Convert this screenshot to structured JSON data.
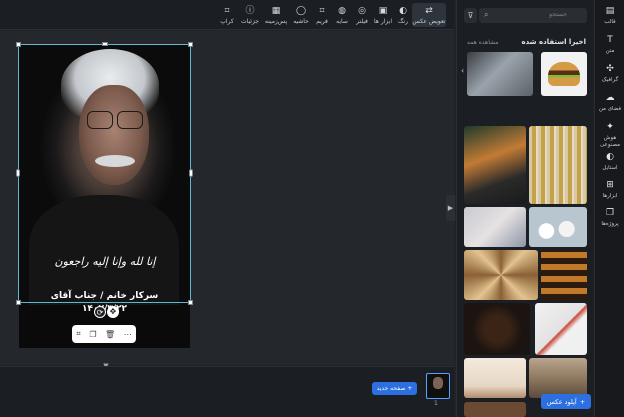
{
  "toolbar": {
    "tools": [
      {
        "id": "change-photo",
        "label": "تعویض عکس",
        "icon": "swap-icon",
        "glyph": "⇄"
      },
      {
        "id": "color",
        "label": "رنگ",
        "icon": "palette-icon",
        "glyph": "◐"
      },
      {
        "id": "photo-tools",
        "label": "ابزار ها",
        "icon": "image-tools-icon",
        "glyph": "▣"
      },
      {
        "id": "filter",
        "label": "فیلتر",
        "icon": "filter-icon",
        "glyph": "◎"
      },
      {
        "id": "shadow",
        "label": "سایه",
        "icon": "shadow-icon",
        "glyph": "◍"
      },
      {
        "id": "frame",
        "label": "فریم",
        "icon": "frame-icon",
        "glyph": "⌗"
      },
      {
        "id": "border",
        "label": "حاشیه",
        "icon": "border-icon",
        "glyph": "◯"
      },
      {
        "id": "background",
        "label": "پس‌زمینه",
        "icon": "background-icon",
        "glyph": "▦"
      },
      {
        "id": "details",
        "label": "جزئیات",
        "icon": "info-icon",
        "glyph": "ⓘ"
      },
      {
        "id": "crop",
        "label": "کراپ",
        "icon": "crop-icon",
        "glyph": "⌗"
      }
    ]
  },
  "design": {
    "calligraphy": "إنا لله وإنا إليه راجعون",
    "subtitle": "سرکار خانم / جناب آقای",
    "date": "۱۴۰۲/۳/۲۲"
  },
  "context_menu": {
    "items": [
      {
        "id": "crop",
        "icon": "crop-icon",
        "glyph": "⌗"
      },
      {
        "id": "duplicate",
        "icon": "duplicate-icon",
        "glyph": "❐"
      },
      {
        "id": "delete",
        "icon": "trash-icon",
        "glyph": "🗑"
      },
      {
        "id": "more",
        "icon": "more-icon",
        "glyph": "⋯"
      }
    ]
  },
  "bottom": {
    "new_page_label": "صفحه جدید",
    "page_number": "1"
  },
  "panel": {
    "search_placeholder": "جستجو",
    "recent_title": "اخیرا استفاده شده",
    "see_all": "مشاهده همه",
    "upload_label": "آپلود عکس"
  },
  "rail": {
    "items": [
      {
        "id": "template",
        "label": "قالب",
        "icon": "layout-icon",
        "glyph": "▤"
      },
      {
        "id": "text",
        "label": "متن",
        "icon": "text-icon",
        "glyph": "T"
      },
      {
        "id": "graphics",
        "label": "گرافیک",
        "icon": "shapes-icon",
        "glyph": "✣"
      },
      {
        "id": "my-space",
        "label": "فضای من",
        "icon": "cloud-upload-icon",
        "glyph": "☁"
      },
      {
        "id": "ai",
        "label": "هوش مصنوعی",
        "icon": "ai-sparkle-icon",
        "glyph": "✦"
      },
      {
        "id": "style",
        "label": "استایل",
        "icon": "palette-icon",
        "glyph": "◐"
      },
      {
        "id": "tools",
        "label": "ابزارها",
        "icon": "tools-grid-icon",
        "glyph": "⊞"
      },
      {
        "id": "projects",
        "label": "پروژه‌ها",
        "icon": "projects-icon",
        "glyph": "❐"
      }
    ]
  },
  "colors": {
    "accent": "#2b6fe0",
    "selection": "#5fb8d0",
    "panel_bg": "#1b1e22",
    "canvas_bg": "#24282d"
  }
}
